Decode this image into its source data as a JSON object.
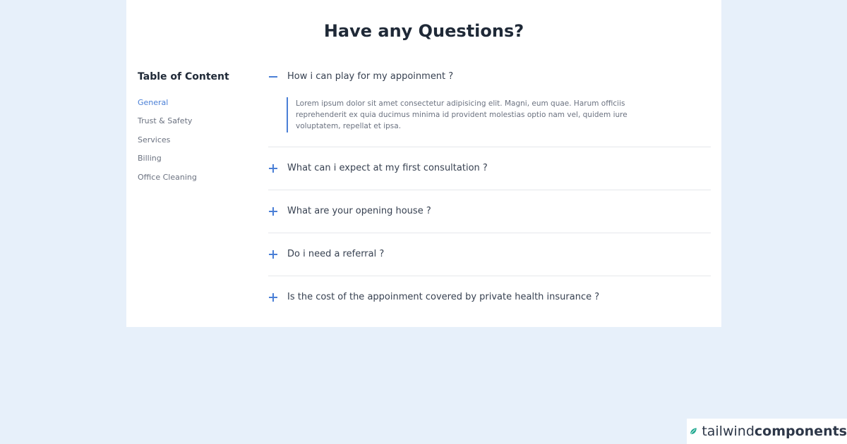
{
  "page": {
    "title": "Have any Questions?"
  },
  "toc": {
    "heading": "Table of Content",
    "items": [
      {
        "label": "General",
        "active": true
      },
      {
        "label": "Trust & Safety",
        "active": false
      },
      {
        "label": "Services",
        "active": false
      },
      {
        "label": "Billing",
        "active": false
      },
      {
        "label": "Office Cleaning",
        "active": false
      }
    ]
  },
  "faq": {
    "items": [
      {
        "question": "How i can play for my appoinment ?",
        "expanded": true,
        "icon": "minus-icon",
        "answer": "Lorem ipsum dolor sit amet consectetur adipisicing elit. Magni, eum quae. Harum officiis reprehenderit ex quia ducimus minima id provident molestias optio nam vel, quidem iure voluptatem, repellat et ipsa."
      },
      {
        "question": "What can i expect at my first consultation ?",
        "expanded": false,
        "icon": "plus-icon"
      },
      {
        "question": "What are your opening house ?",
        "expanded": false,
        "icon": "plus-icon"
      },
      {
        "question": "Do i need a referral ?",
        "expanded": false,
        "icon": "plus-icon"
      },
      {
        "question": "Is the cost of the appoinment covered by private health insurance ?",
        "expanded": false,
        "icon": "plus-icon"
      }
    ]
  },
  "brand": {
    "light": "tailwind",
    "bold": "components",
    "icon": "leaf-logo-icon"
  },
  "colors": {
    "accent": "#4a7fd6",
    "background": "#e7f0fa",
    "brand_green": "#1fa88f"
  }
}
